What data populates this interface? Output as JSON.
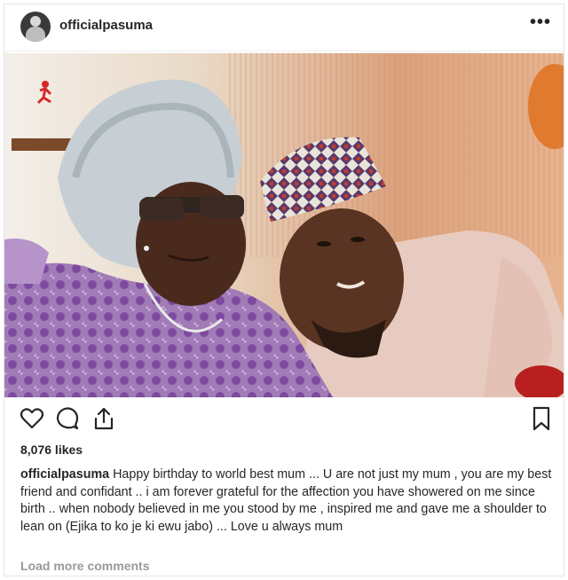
{
  "post": {
    "username": "officialpasuma",
    "more_icon": "more-horizontal-icon",
    "photo_watermark_icon": "runner-logo-icon",
    "actions": {
      "like_icon": "heart-icon",
      "comment_icon": "comment-icon",
      "share_icon": "share-icon",
      "save_icon": "bookmark-icon"
    },
    "likes": "8,076 likes",
    "caption_username": "officialpasuma",
    "caption_text": "Happy birthday to world best mum ... U are not just my mum , you are my best friend and confidant .. i am forever grateful for the affection you have showered on me since birth .. when nobody believed in me you stood by me , inspired me and gave me a shoulder to lean on (Ejika to ko je ki ewu jabo) ... Love u always mum",
    "load_more": "Load more comments"
  }
}
